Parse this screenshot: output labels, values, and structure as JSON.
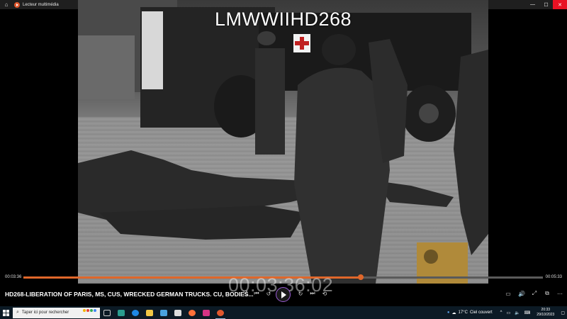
{
  "window": {
    "title": "Lecteur multimédia"
  },
  "video": {
    "watermark": "LMWWIIHD268"
  },
  "seek": {
    "current": "00:03:36",
    "total": "00:05:33",
    "progress": 0.65
  },
  "controls": {
    "big_time": "00:03:36:02",
    "media_title": "HD268-LIBERATION OF PARIS, MS, CUS, WRECKED GERMAN TRUCKS. CU, BODIES...",
    "accent_color": "#e0672a"
  },
  "taskbar": {
    "search_placeholder": "Taper ici pour rechercher",
    "weather": {
      "temp": "17°C",
      "condition": "Ciel couvert"
    },
    "clock": {
      "time": "20:33",
      "date": "29/10/2023"
    }
  }
}
